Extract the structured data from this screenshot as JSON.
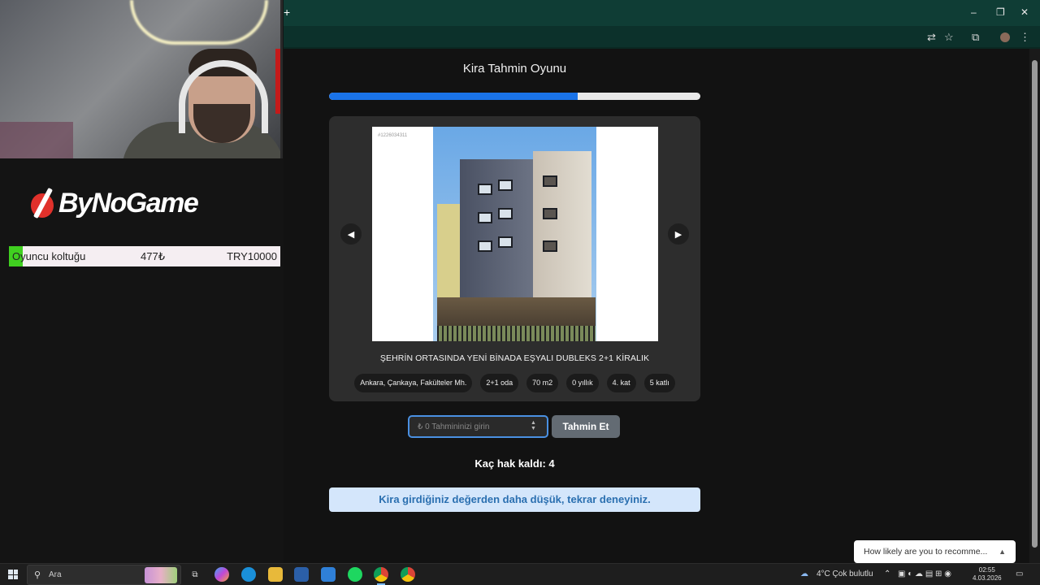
{
  "overlay": {
    "logo_text": "ByNoGame",
    "product": {
      "name": "Oyuncu koltuğu",
      "price": "477₺",
      "target": "TRY10000"
    }
  },
  "browser": {
    "new_tab": "+",
    "window_controls": {
      "minimize": "–",
      "maximize": "❐",
      "close": "✕"
    }
  },
  "game": {
    "title": "Kira Tahmin Oyunu",
    "progress": 0.67,
    "photo_ref": "#1226034311",
    "listing_title": "ŞEHRİN ORTASINDA YENİ BİNADA EŞYALI DUBLEKS 2+1 KİRALIK",
    "tags": [
      "Ankara, Çankaya, Fakülteler Mh.",
      "2+1 oda",
      "70 m2",
      "0 yıllık",
      "4. kat",
      "5 katlı"
    ],
    "input_placeholder": "₺ 0 Tahmininizi girin",
    "guess_button": "Tahmin Et",
    "attempts_text": "Kaç hak kaldı: 4",
    "alert_text": "Kira girdiğiniz değerden daha düşük, tekrar deneyiniz."
  },
  "survey": {
    "text": "How likely are you to recomme..."
  },
  "taskbar": {
    "search_placeholder": "Ara",
    "weather": "4°C  Çok bulutlu",
    "time": "02:55",
    "date": "4.03.2026"
  },
  "colors": {
    "accent": "#1a73e8",
    "alert_bg": "#d4e6fb",
    "titlebar": "#0f3d35"
  }
}
